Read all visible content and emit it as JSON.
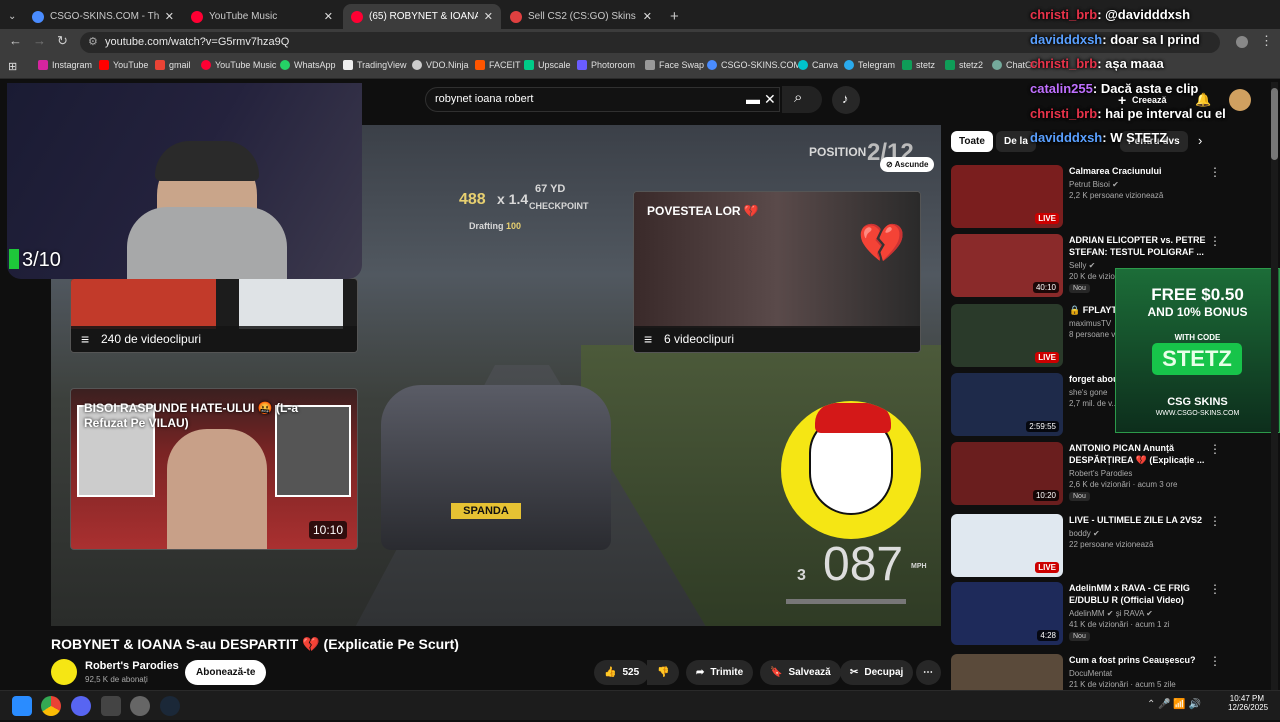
{
  "browser": {
    "tabs": [
      {
        "title": "CSGO-SKINS.COM - The best C",
        "color": "#4a8cff",
        "active": false
      },
      {
        "title": "YouTube Music",
        "color": "#ff0033",
        "active": false
      },
      {
        "title": "(65) ROBYNET & IOANA S-au D",
        "color": "#ff0033",
        "active": true
      },
      {
        "title": "Sell CS2 (CS:GO) Skins | Best CS",
        "color": "#e04040",
        "active": false
      }
    ],
    "url": "youtube.com/watch?v=G5rmv7hza9Q",
    "bookmarks": [
      "Instagram",
      "YouTube",
      "gmail",
      "YouTube Music",
      "WhatsApp",
      "TradingView",
      "VDO.Ninja",
      "FACEIT",
      "Upscale",
      "Photoroom",
      "Face Swap",
      "CSGO-SKINS.COM",
      "Canva",
      "Telegram",
      "stetz",
      "stetz2",
      "ChatGP"
    ]
  },
  "youtube": {
    "search_value": "robynet ioana robert",
    "create_label": "Creează",
    "chips": [
      "Toate",
      "De la ",
      "Pentru dvs"
    ],
    "video_title": "ROBYNET & IOANA S-au DESPARTIT 💔 (Explicatie Pe Scurt)",
    "channel": "Robert's Parodies",
    "subscribers": "92,5 K de abonați",
    "subscribe_label": "Abonează-te",
    "likes": "525",
    "share_label": "Trimite",
    "save_label": "Salvează",
    "clip_label": "Decupaj"
  },
  "player": {
    "hide_label": "Ascunde",
    "position_label": "POSITION",
    "position_value": "2/12",
    "score": "488",
    "multiplier": "x 1.4",
    "distance": "67 YD",
    "checkpoint": "CHECKPOINT",
    "drafting": "Drafting",
    "drafting_value": "100",
    "plate": "SPANDA",
    "gear": "3",
    "speed": "087",
    "speed_unit": "MPH",
    "card_playlist_1": "240 de videoclipuri",
    "card_playlist_2_title": "POVESTEA LOR 💔",
    "card_playlist_2_count": "6 videoclipuri",
    "card_video_title": "BISOI RASPUNDE HATE-ULUI 🤬 (L-a Refuzat Pe VILAU)",
    "card_video_duration": "10:10",
    "webcam_counter": "3/10"
  },
  "recommended": [
    {
      "title": "Calmarea Craciunului",
      "channel": "Petrut Bisoi ✔",
      "meta": "2,2 K persoane vizionează",
      "badge": "LIVE",
      "new": false,
      "thumb": "#7a1e1e"
    },
    {
      "title": "ADRIAN ELICOPTER vs. PETRE STEFAN: TESTUL POLIGRAF ...",
      "channel": "Selly ✔",
      "meta": "20 K de vizionări",
      "badge": "40:10",
      "new": true,
      "thumb": "#8a2a2a"
    },
    {
      "title": "🔒 FPLAYT... TASKURILE...",
      "channel": "maximusTV",
      "meta": "8 persoane v...",
      "badge": "LIVE",
      "new": false,
      "thumb": "#2a3a2a"
    },
    {
      "title": "forget abou...",
      "channel": "she's gone",
      "meta": "2,7 mil. de v...",
      "badge": "2:59:55",
      "new": false,
      "thumb": "#1e2a4a"
    },
    {
      "title": "ANTONIO PICAN Anunță DESPĂRȚIREA 💔 (Explicație ...",
      "channel": "Robert's Parodies",
      "meta": "2,6 K de vizionări · acum 3 ore",
      "badge": "10:20",
      "new": true,
      "thumb": "#6a1e1e"
    },
    {
      "title": "LIVE - ULTIMELE ZILE LA 2VS2",
      "channel": "boddy ✔",
      "meta": "22 persoane vizionează",
      "badge": "LIVE",
      "new": false,
      "thumb": "#e0e8f0"
    },
    {
      "title": "AdelinMM x RAVA - CE FRIG E/DUBLU R (Official Video)",
      "channel": "AdelinMM ✔ și RAVA ✔",
      "meta": "41 K de vizionări · acum 1 zi",
      "badge": "4:28",
      "new": true,
      "thumb": "#1e2a5a"
    },
    {
      "title": "Cum a fost prins Ceaușescu?",
      "channel": "DocuMentat",
      "meta": "21 K de vizionări · acum 5 zile",
      "badge": "",
      "new": false,
      "thumb": "#5a4a3a"
    }
  ],
  "promo": {
    "line1": "FREE $0.50",
    "line2": "AND 10% BONUS",
    "line3": "WITH CODE",
    "code": "STETZ",
    "brand": "CSG SKINS",
    "site": "WWW.CSGO-SKINS.COM"
  },
  "chat": [
    {
      "user": "christi_brb",
      "msg": ": @davidddxsh",
      "color": "#e8334a"
    },
    {
      "user": "davidddxsh",
      "msg": ": doar sa I prind",
      "color": "#5aa0ff"
    },
    {
      "user": "christi_brb",
      "msg": ": așa maaa",
      "color": "#e8334a"
    },
    {
      "user": "catalin255",
      "msg": ": Dacă asta e clip",
      "color": "#c070ff"
    },
    {
      "user": "christi_brb",
      "msg": ": hai pe interval cu el",
      "color": "#e8334a"
    },
    {
      "user": "davidddxsh",
      "msg": ": W STETZ",
      "color": "#5aa0ff"
    }
  ],
  "taskbar": {
    "time": "10:47 PM",
    "date": "12/26/2025"
  }
}
